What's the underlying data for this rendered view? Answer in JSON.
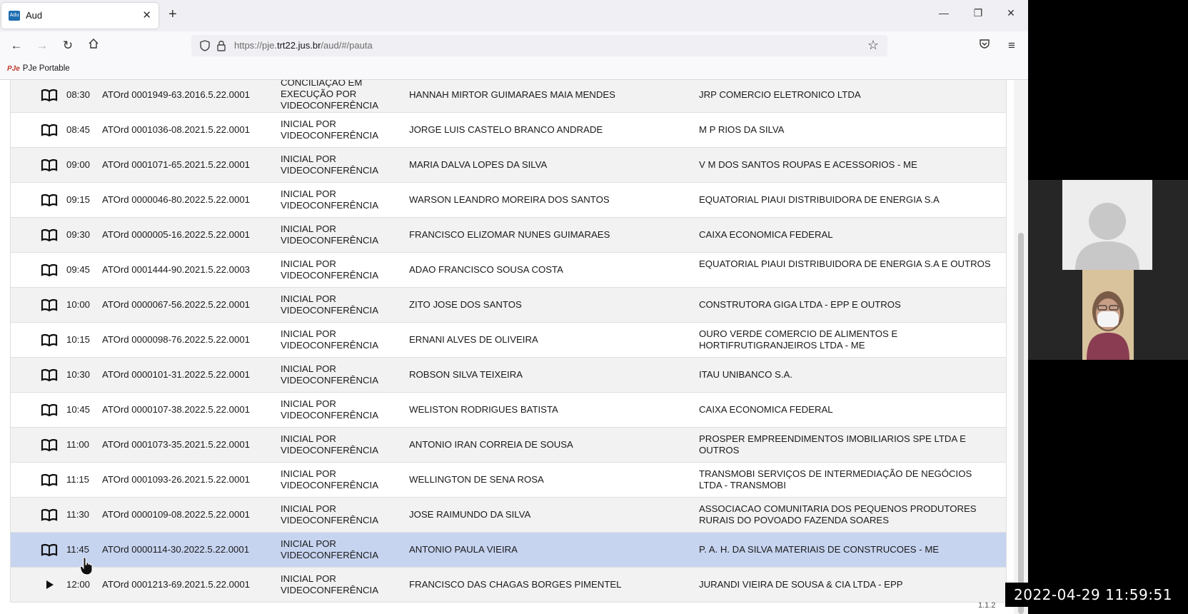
{
  "browser": {
    "tab_title": "Aud",
    "favicon_text": "Adu",
    "url_prefix": "https://pje.",
    "url_host": "trt22.jus.br",
    "url_path": "/aud/#/pauta",
    "bookmark_icon_text": "PJe",
    "bookmark_label": "PJe Portable"
  },
  "hearings": [
    {
      "icon": "book-icon",
      "time": "08:30",
      "process": "ATOrd 0001949-63.2016.5.22.0001",
      "type": "CONCILIAÇÃO EM EXECUÇÃO POR VIDEOCONFERÊNCIA",
      "author": "HANNAH MIRTOR GUIMARAES MAIA MENDES",
      "defendant": "JRP COMERCIO ELETRONICO LTDA"
    },
    {
      "icon": "book-icon",
      "time": "08:45",
      "process": "ATOrd 0001036-08.2021.5.22.0001",
      "type": "INICIAL POR VIDEOCONFERÊNCIA",
      "author": "JORGE LUIS CASTELO BRANCO ANDRADE",
      "defendant": "M P RIOS DA SILVA"
    },
    {
      "icon": "book-icon",
      "time": "09:00",
      "process": "ATOrd 0001071-65.2021.5.22.0001",
      "type": "INICIAL POR VIDEOCONFERÊNCIA",
      "author": "MARIA DALVA LOPES DA SILVA",
      "defendant": "V M DOS SANTOS ROUPAS E ACESSORIOS - ME"
    },
    {
      "icon": "book-icon",
      "time": "09:15",
      "process": "ATOrd 0000046-80.2022.5.22.0001",
      "type": "INICIAL POR VIDEOCONFERÊNCIA",
      "author": "WARSON LEANDRO MOREIRA DOS SANTOS",
      "defendant": "EQUATORIAL PIAUI DISTRIBUIDORA DE ENERGIA S.A"
    },
    {
      "icon": "book-icon",
      "time": "09:30",
      "process": "ATOrd 0000005-16.2022.5.22.0001",
      "type": "INICIAL POR VIDEOCONFERÊNCIA",
      "author": "FRANCISCO ELIZOMAR NUNES GUIMARAES",
      "defendant": "CAIXA ECONOMICA FEDERAL"
    },
    {
      "icon": "book-icon",
      "time": "09:45",
      "process": "ATOrd 0001444-90.2021.5.22.0003",
      "type": "INICIAL POR VIDEOCONFERÊNCIA",
      "author": "ADAO FRANCISCO SOUSA COSTA",
      "defendant": "EQUATORIAL PIAUI DISTRIBUIDORA DE ENERGIA S.A E OUTROS"
    },
    {
      "icon": "book-icon",
      "time": "10:00",
      "process": "ATOrd 0000067-56.2022.5.22.0001",
      "type": "INICIAL POR VIDEOCONFERÊNCIA",
      "author": "ZITO JOSE DOS SANTOS",
      "defendant": "CONSTRUTORA GIGA LTDA - EPP E OUTROS"
    },
    {
      "icon": "book-icon",
      "time": "10:15",
      "process": "ATOrd 0000098-76.2022.5.22.0001",
      "type": "INICIAL POR VIDEOCONFERÊNCIA",
      "author": "ERNANI ALVES DE OLIVEIRA",
      "defendant": "OURO VERDE COMERCIO DE ALIMENTOS E HORTIFRUTIGRANJEIROS LTDA - ME"
    },
    {
      "icon": "book-icon",
      "time": "10:30",
      "process": "ATOrd 0000101-31.2022.5.22.0001",
      "type": "INICIAL POR VIDEOCONFERÊNCIA",
      "author": "ROBSON SILVA TEIXEIRA",
      "defendant": "ITAU UNIBANCO S.A."
    },
    {
      "icon": "book-icon",
      "time": "10:45",
      "process": "ATOrd 0000107-38.2022.5.22.0001",
      "type": "INICIAL POR VIDEOCONFERÊNCIA",
      "author": "WELISTON RODRIGUES BATISTA",
      "defendant": "CAIXA ECONOMICA FEDERAL"
    },
    {
      "icon": "book-icon",
      "time": "11:00",
      "process": "ATOrd 0001073-35.2021.5.22.0001",
      "type": "INICIAL POR VIDEOCONFERÊNCIA",
      "author": "ANTONIO IRAN CORREIA DE SOUSA",
      "defendant": "PROSPER EMPREENDIMENTOS IMOBILIARIOS SPE LTDA E OUTROS"
    },
    {
      "icon": "book-icon",
      "time": "11:15",
      "process": "ATOrd 0001093-26.2021.5.22.0001",
      "type": "INICIAL POR VIDEOCONFERÊNCIA",
      "author": "WELLINGTON DE SENA ROSA",
      "defendant": "TRANSMOBI SERVIÇOS DE INTERMEDIAÇÃO DE NEGÓCIOS LTDA - TRANSMOBI"
    },
    {
      "icon": "book-icon",
      "time": "11:30",
      "process": "ATOrd 0000109-08.2022.5.22.0001",
      "type": "INICIAL POR VIDEOCONFERÊNCIA",
      "author": "JOSE RAIMUNDO DA SILVA",
      "defendant": "ASSOCIACAO COMUNITARIA DOS PEQUENOS PRODUTORES RURAIS DO POVOADO FAZENDA SOARES"
    },
    {
      "icon": "book-icon",
      "time": "11:45",
      "process": "ATOrd 0000114-30.2022.5.22.0001",
      "type": "INICIAL POR VIDEOCONFERÊNCIA",
      "author": "ANTONIO PAULA VIEIRA",
      "defendant": "P. A. H. DA SILVA MATERIAIS DE CONSTRUCOES - ME",
      "selected": true
    },
    {
      "icon": "play-icon",
      "time": "12:00",
      "process": "ATOrd 0001213-69.2021.5.22.0001",
      "type": "INICIAL POR VIDEOCONFERÊNCIA",
      "author": "FRANCISCO DAS CHAGAS BORGES PIMENTEL",
      "defendant": "JURANDI VIEIRA DE SOUSA & CIA LTDA - EPP"
    }
  ],
  "version": "1.1.2",
  "recording_timestamp": "2022-04-29 11:59:51",
  "colors": {
    "selected_row": "#c7d4f0",
    "alt_row": "#f2f2f2"
  }
}
